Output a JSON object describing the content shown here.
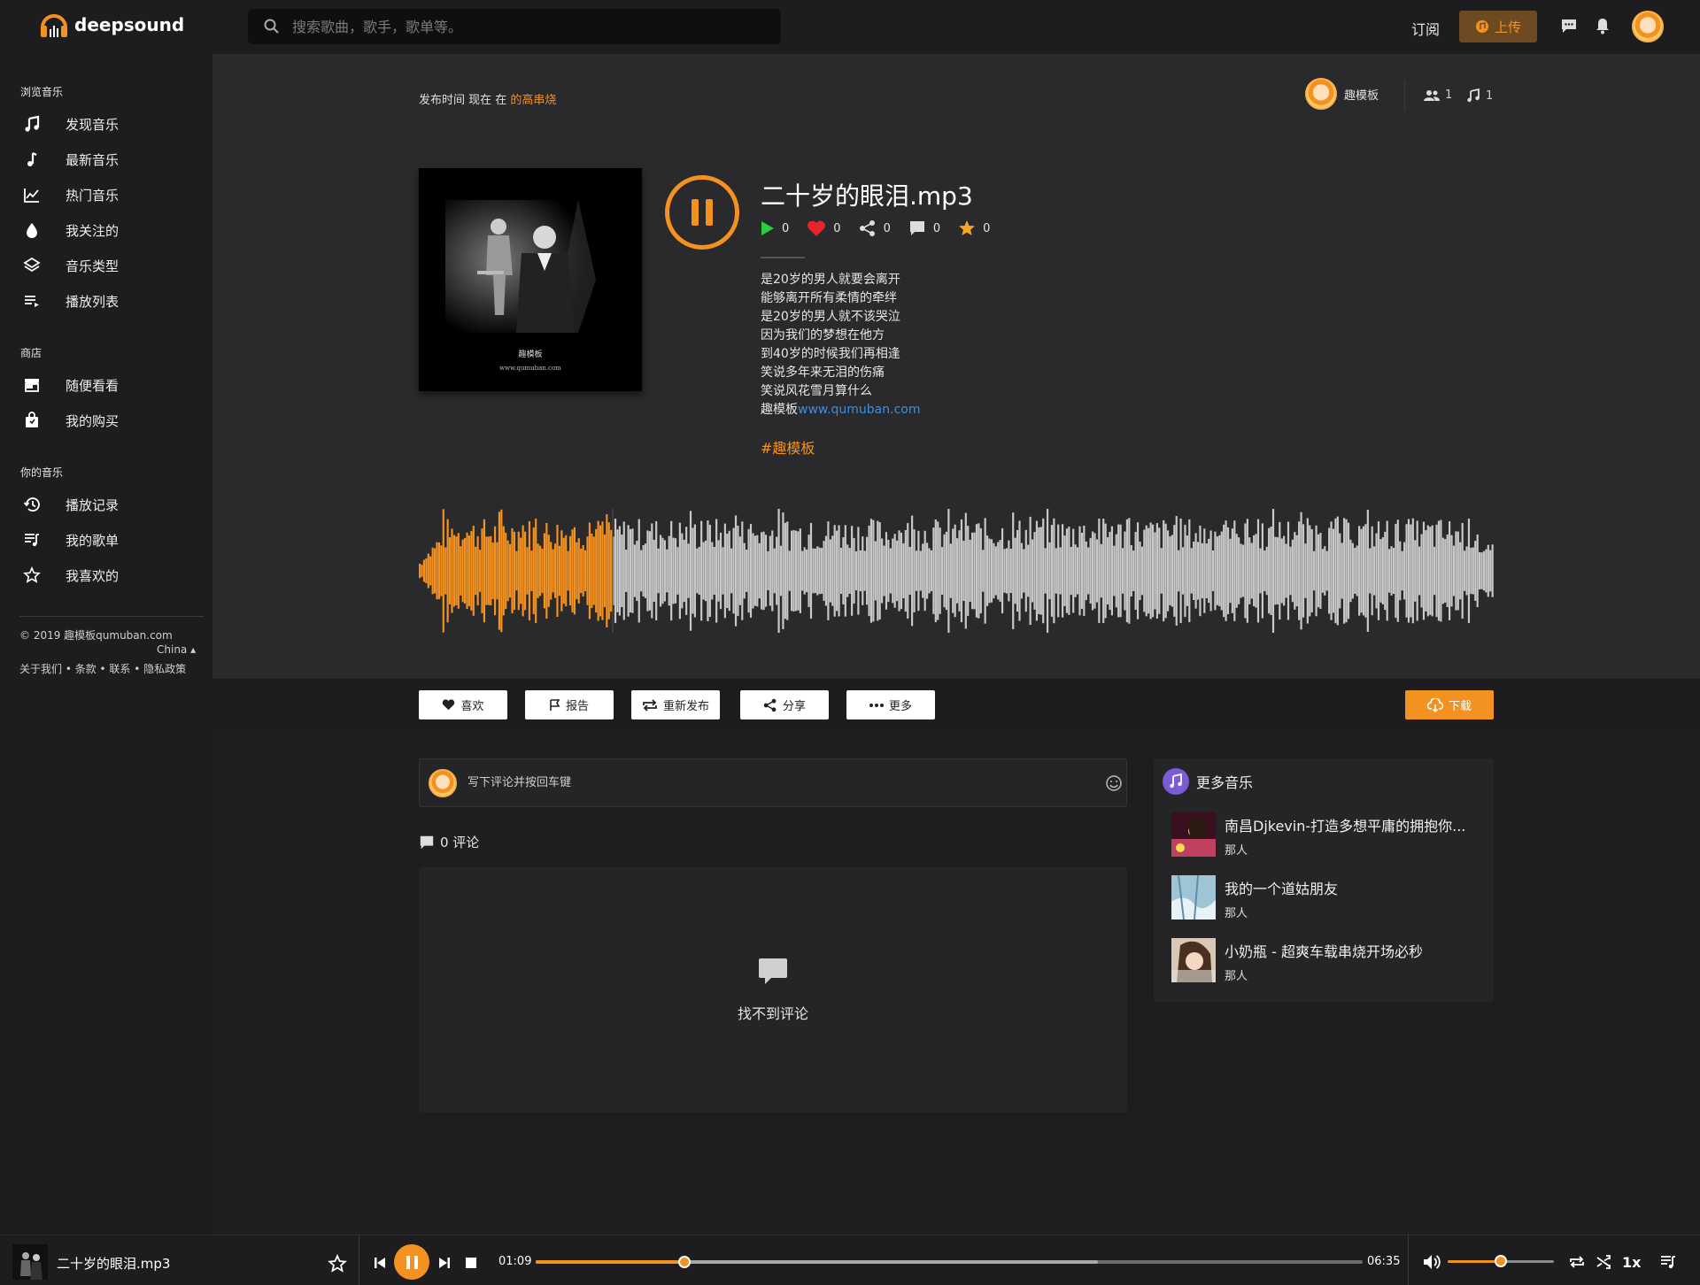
{
  "header": {
    "logo_text": "deepsound",
    "search_placeholder": "搜索歌曲，歌手，歌单等。",
    "subscribe_label": "订阅",
    "upload_label": "上传"
  },
  "sidebar": {
    "browse_title": "浏览音乐",
    "browse_items": [
      {
        "label": "发现音乐",
        "icon": "music-note-icon"
      },
      {
        "label": "最新音乐",
        "icon": "single-note-icon"
      },
      {
        "label": "热门音乐",
        "icon": "trending-icon"
      },
      {
        "label": "我关注的",
        "icon": "drop-icon"
      },
      {
        "label": "音乐类型",
        "icon": "layers-icon"
      },
      {
        "label": "播放列表",
        "icon": "playlist-icon"
      }
    ],
    "store_title": "商店",
    "store_items": [
      {
        "label": "随便看看",
        "icon": "store-icon"
      },
      {
        "label": "我的购买",
        "icon": "shopping-bag-icon"
      }
    ],
    "your_title": "你的音乐",
    "your_items": [
      {
        "label": "播放记录",
        "icon": "history-icon"
      },
      {
        "label": "我的歌单",
        "icon": "queue-music-icon"
      },
      {
        "label": "我喜欢的",
        "icon": "star-outline-icon"
      }
    ],
    "copyright": "© 2019 趣模板qumuban.com",
    "language": "China",
    "footer_links": "关于我们 • 条款 • 联系 • 隐私政策"
  },
  "track": {
    "published_prefix": "发布时间 现在 在",
    "genre_link": "的高串烧",
    "owner_name": "趣模板",
    "followers": "1",
    "tracks": "1",
    "title": "二十岁的眼泪.mp3",
    "cover_title": "趣模板",
    "cover_url": "www.qumuban.com",
    "plays": "0",
    "likes": "0",
    "shares": "0",
    "comments": "0",
    "favorites": "0",
    "lyrics": [
      "是20岁的男人就要会离开",
      "能够离开所有柔情的牵绊",
      "是20岁的男人就不该哭泣",
      "因为我们的梦想在他方",
      "到40岁的时候我们再相逢",
      "笑说多年来无泪的伤痛",
      "笑说风花雪月算什么"
    ],
    "lyrics_last_prefix": "趣模板",
    "lyrics_last_link": "www.qumuban.com",
    "tag": "#趣模板",
    "progress_fraction": 0.18
  },
  "actions": {
    "like": "喜欢",
    "report": "报告",
    "repost": "重新发布",
    "share": "分享",
    "more": "更多",
    "download": "下载"
  },
  "comments": {
    "placeholder": "写下评论并按回车键",
    "count_label": "0 评论",
    "empty_text": "找不到评论"
  },
  "more_music": {
    "title": "更多音乐",
    "items": [
      {
        "name": "南昌Djkevin-打造多想平庸的拥抱你...",
        "artist": "那人"
      },
      {
        "name": "我的一个道姑朋友",
        "artist": "那人"
      },
      {
        "name": "小奶瓶 - 超爽车载串烧开场必秒",
        "artist": "那人"
      }
    ]
  },
  "player": {
    "title": "二十岁的眼泪.mp3",
    "current_time": "01:09",
    "total_time": "06:35",
    "speed": "1x",
    "progress_fraction": 0.18,
    "buffered_fraction": 0.68,
    "volume_fraction": 0.5
  },
  "colors": {
    "accent": "#f39121",
    "background": "#2a2a2c",
    "panel": "#1d1d1f",
    "link": "#3b8fe0"
  }
}
